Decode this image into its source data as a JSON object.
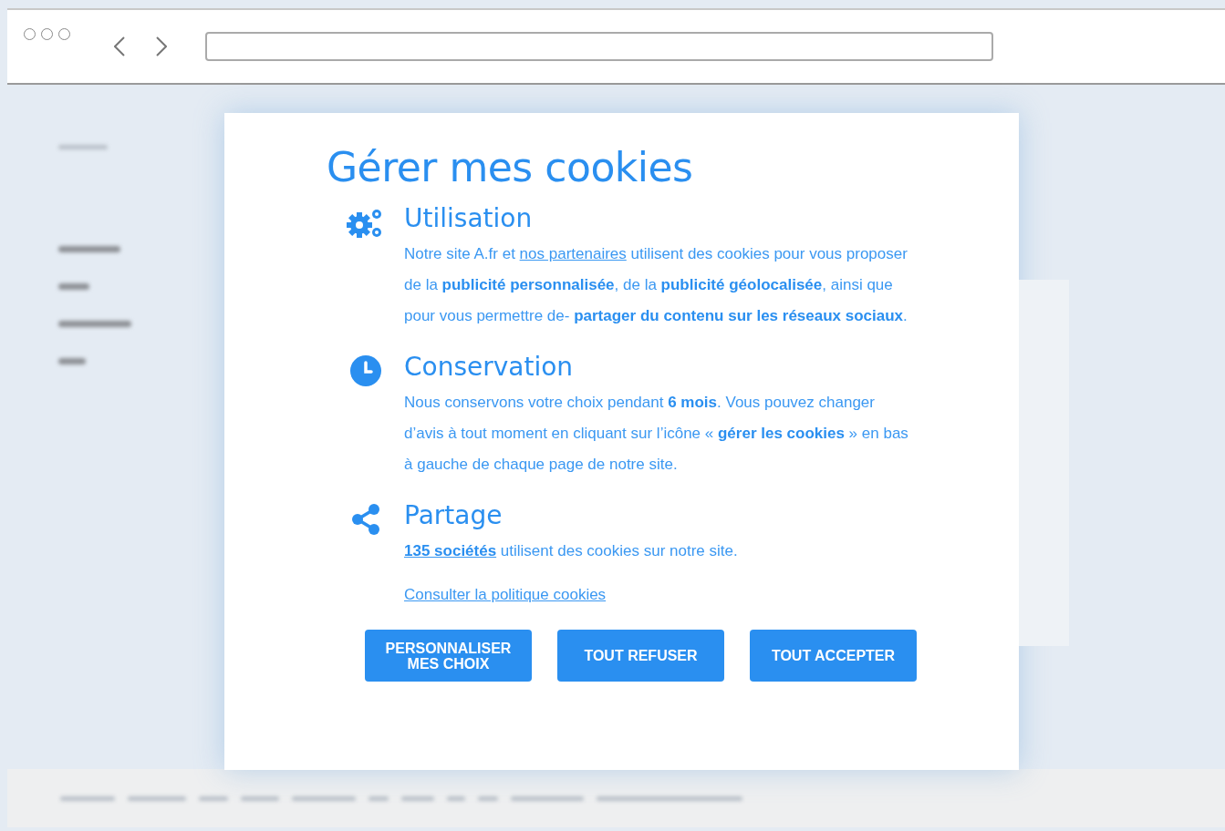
{
  "dialog": {
    "title": "Gérer mes cookies",
    "sections": [
      {
        "heading": "Utilisation",
        "parts": [
          {
            "kind": "plain",
            "text": "Notre site A.fr et "
          },
          {
            "kind": "link",
            "text": "nos partenaires"
          },
          {
            "kind": "plain",
            "text": " utilisent des cookies pour vous proposer de la "
          },
          {
            "kind": "bold",
            "text": "publicité personnalisée"
          },
          {
            "kind": "plain",
            "text": ", de la "
          },
          {
            "kind": "bold",
            "text": "publicité géolocalisée"
          },
          {
            "kind": "plain",
            "text": ", ainsi que pour vous permettre de- "
          },
          {
            "kind": "bold",
            "text": "partager du contenu sur les réseaux sociaux"
          },
          {
            "kind": "plain",
            "text": "."
          }
        ]
      },
      {
        "heading": "Conservation",
        "parts": [
          {
            "kind": "plain",
            "text": "Nous conservons votre choix pendant "
          },
          {
            "kind": "bold",
            "text": "6 mois"
          },
          {
            "kind": "plain",
            "text": ". Vous pouvez changer d’avis à tout moment en cliquant sur l’icône « "
          },
          {
            "kind": "bold",
            "text": "gérer les cookies"
          },
          {
            "kind": "plain",
            "text": " » en bas à gauche de chaque page de notre site."
          }
        ]
      },
      {
        "heading": "Partage",
        "parts": [
          {
            "kind": "bold_link",
            "text": "135 sociétés"
          },
          {
            "kind": "plain",
            "text": " utilisent des cookies sur notre site."
          }
        ]
      }
    ],
    "policy_link": "Consulter la politique cookies",
    "buttons": [
      "PERSONNALISER MES CHOIX",
      "TOUT REFUSER",
      "TOUT ACCEPTER"
    ]
  }
}
